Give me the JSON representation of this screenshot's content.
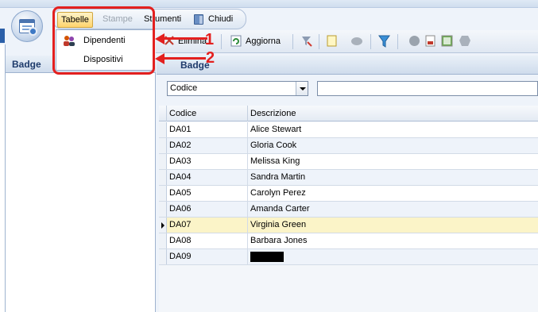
{
  "menubar": {
    "items": [
      {
        "label": "Tabelle",
        "state": "active"
      },
      {
        "label": "Stampe",
        "state": "disabled"
      },
      {
        "label": "Strumenti",
        "state": "normal"
      },
      {
        "label": "Chiudi",
        "state": "normal"
      }
    ]
  },
  "dropdown": {
    "items": [
      {
        "label": "Dipendenti",
        "icon": "people-icon"
      },
      {
        "label": "Dispositivi",
        "icon": ""
      }
    ]
  },
  "toolbar": {
    "elimina_label": "Elimina",
    "aggiorna_label": "Aggiorna"
  },
  "left_panel": {
    "title": "Badge"
  },
  "right_panel": {
    "title": "Badge"
  },
  "filter": {
    "field_value": "Codice",
    "text_value": ""
  },
  "grid": {
    "columns": [
      "Codice",
      "Descrizione"
    ],
    "rows": [
      {
        "codice": "DA01",
        "descrizione": "Alice Stewart"
      },
      {
        "codice": "DA02",
        "descrizione": "Gloria Cook"
      },
      {
        "codice": "DA03",
        "descrizione": "Melissa King"
      },
      {
        "codice": "DA04",
        "descrizione": "Sandra Martin"
      },
      {
        "codice": "DA05",
        "descrizione": "Carolyn Perez"
      },
      {
        "codice": "DA06",
        "descrizione": "Amanda Carter"
      },
      {
        "codice": "DA07",
        "descrizione": "Virginia Green"
      },
      {
        "codice": "DA08",
        "descrizione": "Barbara Jones"
      },
      {
        "codice": "DA09",
        "descrizione": ""
      }
    ],
    "current_row_code": "DA07"
  },
  "annotations": {
    "one": "1",
    "two": "2"
  },
  "colors": {
    "annotation": "#e3201f",
    "current_row": "#fbf4c8",
    "accent": "#1d3a6b"
  }
}
